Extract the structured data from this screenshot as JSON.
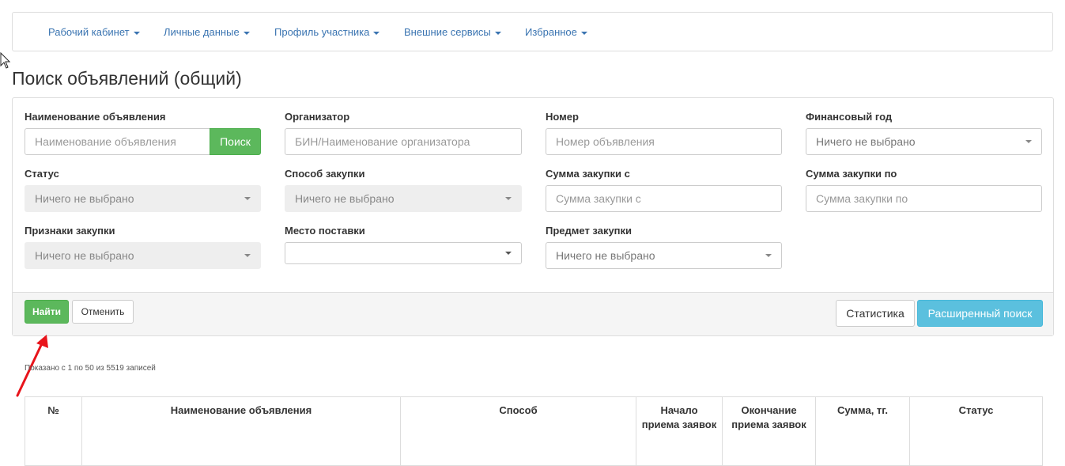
{
  "nav": {
    "items": [
      {
        "label": "Рабочий кабинет"
      },
      {
        "label": "Личные данные"
      },
      {
        "label": "Профиль участника"
      },
      {
        "label": "Внешние сервисы"
      },
      {
        "label": "Избранное"
      }
    ]
  },
  "page": {
    "title": "Поиск объявлений (общий)"
  },
  "filters": {
    "name": {
      "label": "Наименование объявления",
      "placeholder": "Наименование объявления",
      "search_button": "Поиск"
    },
    "organizer": {
      "label": "Организатор",
      "placeholder": "БИН/Наименование организатора"
    },
    "number": {
      "label": "Номер",
      "placeholder": "Номер объявления"
    },
    "fin_year": {
      "label": "Финансовый год",
      "value": "Ничего не выбрано"
    },
    "status": {
      "label": "Статус",
      "value": "Ничего не выбрано"
    },
    "method": {
      "label": "Способ закупки",
      "value": "Ничего не выбрано"
    },
    "sum_from": {
      "label": "Сумма закупки с",
      "placeholder": "Сумма закупки с"
    },
    "sum_to": {
      "label": "Сумма закупки по",
      "placeholder": "Сумма закупки по"
    },
    "signs": {
      "label": "Признаки закупки",
      "value": "Ничего не выбрано"
    },
    "place": {
      "label": "Место поставки",
      "value": ""
    },
    "subject": {
      "label": "Предмет закупки",
      "value": "Ничего не выбрано"
    }
  },
  "actions": {
    "find": "Найти",
    "cancel": "Отменить",
    "statistics": "Статистика",
    "advanced": "Расширенный поиск"
  },
  "results": {
    "info": "Показано с 1 по 50 из 5519 записей",
    "columns": [
      "№",
      "Наименование объявления",
      "Способ",
      "Начало приема заявок",
      "Окончание приема заявок",
      "Сумма, тг.",
      "Статус"
    ]
  },
  "colors": {
    "link": "#3a74b1",
    "success": "#5cb85c",
    "info": "#5bc0de",
    "annotation_arrow": "#e8141b"
  }
}
